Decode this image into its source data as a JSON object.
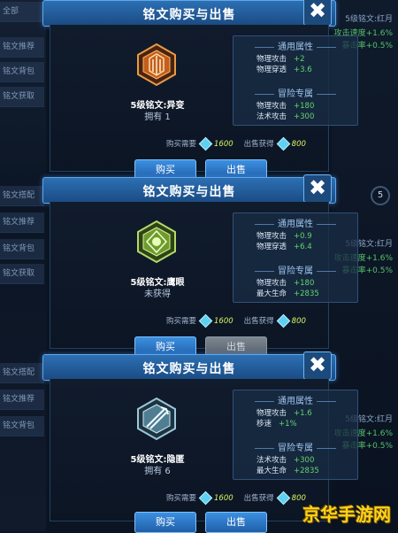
{
  "background": {
    "left_tabs": [
      "全部",
      "铭文推荐",
      "铭文背包",
      "铭文获取",
      "铭文搭配",
      "铭文推荐",
      "铭文背包",
      "铭文获取",
      "铭文搭配",
      "铭文推荐",
      "铭文背包"
    ],
    "right_lines": [
      "5级铭文:红月",
      "攻击速度+1.6%",
      "暴击率+0.5%",
      "5级铭文:红月",
      "攻击速度+1.6%",
      "暴击率+0.5%",
      "5级铭文:红月",
      "攻击速度+1.6%",
      "暴击率+0.5%"
    ],
    "ring_level": "5"
  },
  "dialogs": [
    {
      "title": "铭文购买与出售",
      "close": "✖",
      "rune_name": "5级铭文:异变",
      "owned": "拥有 1",
      "icon_color": "#e0782a",
      "general_header": "通用属性",
      "general_attrs": [
        {
          "name": "物理攻击",
          "value": "+2"
        },
        {
          "name": "物理穿透",
          "value": "+3.6"
        }
      ],
      "adventure_header": "冒险专属",
      "adventure_attrs": [
        {
          "name": "物理攻击",
          "value": "+180"
        },
        {
          "name": "法术攻击",
          "value": "+300"
        }
      ],
      "buy_label": "购买需要",
      "buy_price": "1600",
      "sell_label": "出售获得",
      "sell_price": "800",
      "buy_button": "购买",
      "sell_button": "出售",
      "sell_enabled": true
    },
    {
      "title": "铭文购买与出售",
      "close": "✖",
      "rune_name": "5级铭文:鹰眼",
      "owned": "未获得",
      "icon_color": "#8dc04a",
      "general_header": "通用属性",
      "general_attrs": [
        {
          "name": "物理攻击",
          "value": "+0.9"
        },
        {
          "name": "物理穿透",
          "value": "+6.4"
        }
      ],
      "adventure_header": "冒险专属",
      "adventure_attrs": [
        {
          "name": "物理攻击",
          "value": "+180"
        },
        {
          "name": "最大生命",
          "value": "+2835"
        }
      ],
      "buy_label": "购买需要",
      "buy_price": "1600",
      "sell_label": "出售获得",
      "sell_price": "800",
      "buy_button": "购买",
      "sell_button": "出售",
      "sell_enabled": false
    },
    {
      "title": "铭文购买与出售",
      "close": "✖",
      "rune_name": "5级铭文:隐匿",
      "owned": "拥有 6",
      "icon_color": "#7fb0c8",
      "general_header": "通用属性",
      "general_attrs": [
        {
          "name": "物理攻击",
          "value": "+1.6"
        },
        {
          "name": "移速",
          "value": "+1%"
        }
      ],
      "adventure_header": "冒险专属",
      "adventure_attrs": [
        {
          "name": "法术攻击",
          "value": "+300"
        },
        {
          "name": "最大生命",
          "value": "+2835"
        }
      ],
      "buy_label": "购买需要",
      "buy_price": "1600",
      "sell_label": "出售获得",
      "sell_price": "800",
      "buy_button": "购买",
      "sell_button": "出售",
      "sell_enabled": true
    }
  ],
  "watermark": "京华手游网"
}
